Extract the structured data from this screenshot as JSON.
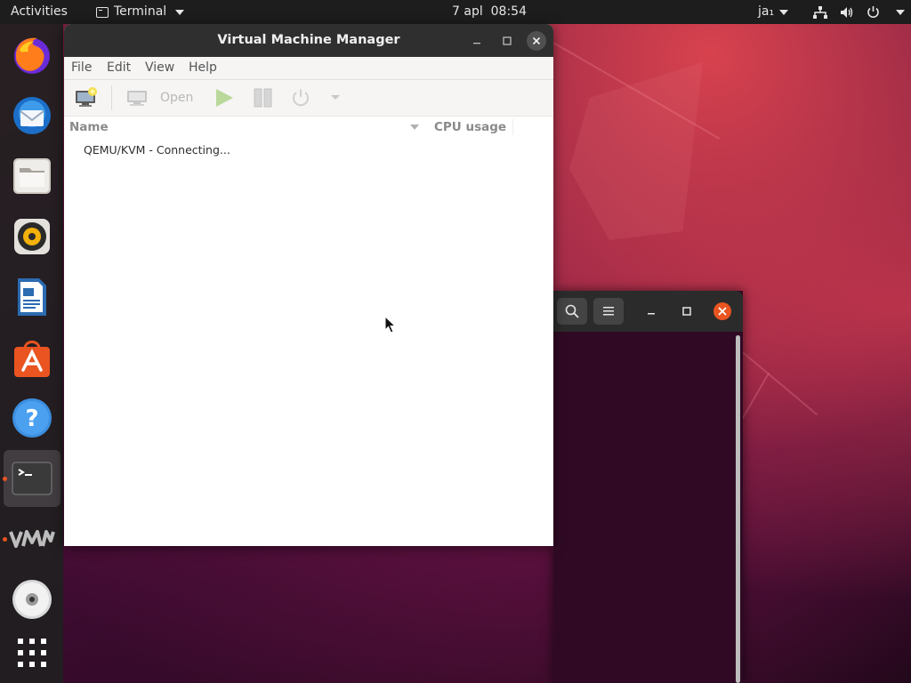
{
  "topbar": {
    "activities": "Activities",
    "app_name": "Terminal",
    "clock": "7 apl  08:54",
    "input_lang": "ja₁"
  },
  "dock": {
    "items": [
      {
        "name": "Firefox"
      },
      {
        "name": "Thunderbird"
      },
      {
        "name": "Files"
      },
      {
        "name": "Rhythmbox"
      },
      {
        "name": "LibreOffice Writer"
      },
      {
        "name": "Ubuntu Software"
      },
      {
        "name": "Help"
      },
      {
        "name": "Terminal",
        "running": true,
        "active": true
      },
      {
        "name": "Virtual Machine Manager",
        "running": true
      },
      {
        "name": "Disc"
      },
      {
        "name": "Show Applications"
      }
    ]
  },
  "vmm": {
    "title": "Virtual Machine Manager",
    "menu": [
      "File",
      "Edit",
      "View",
      "Help"
    ],
    "toolbar": {
      "open_label": "Open"
    },
    "columns": {
      "name": "Name",
      "cpu": "CPU usage"
    },
    "rows": [
      {
        "label": "QEMU/KVM - Connecting..."
      }
    ]
  },
  "colors": {
    "accent": "#e95420",
    "titlebar": "#2f2f2f",
    "topbar": "#1d1d1d",
    "terminal_bg": "#300a24"
  }
}
